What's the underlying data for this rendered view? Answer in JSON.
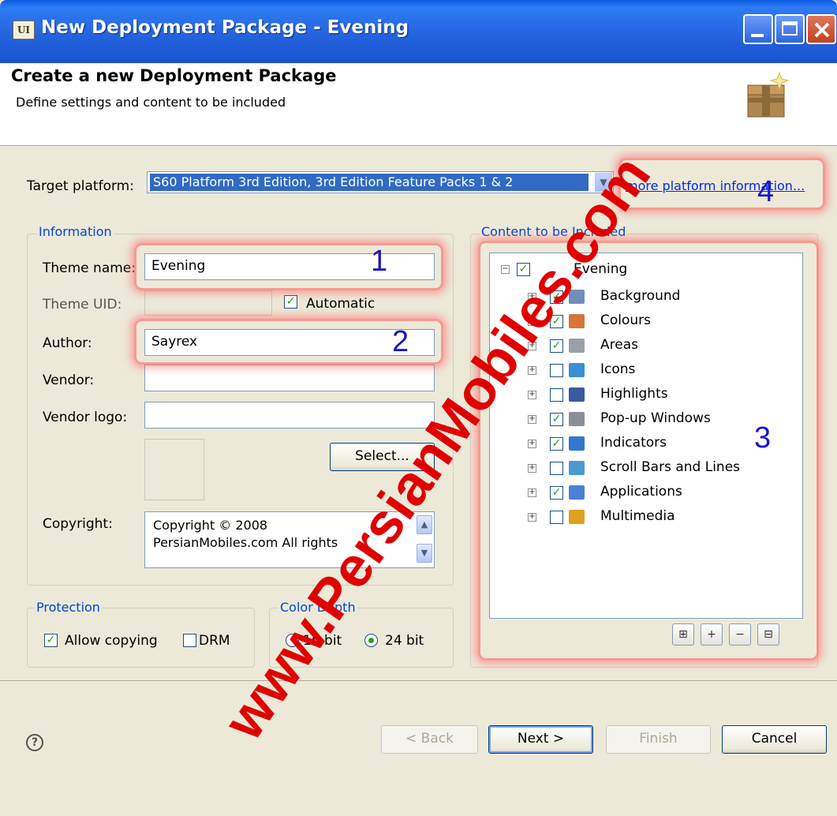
{
  "window": {
    "title": "New Deployment Package - Evening",
    "app_icon_text": "UI"
  },
  "header": {
    "title": "Create a new Deployment Package",
    "subtitle": "Define settings and content to be included"
  },
  "target_platform": {
    "label": "Target platform:",
    "value": "S60 Platform 3rd Edition, 3rd Edition Feature Packs 1 & 2",
    "more_link": "more platform information..."
  },
  "information": {
    "title": "Information",
    "theme_name_label": "Theme name:",
    "theme_name": "Evening",
    "theme_uid_label": "Theme UID:",
    "theme_uid": "",
    "automatic_label": "Automatic",
    "automatic_checked": true,
    "author_label": "Author:",
    "author": "Sayrex",
    "vendor_label": "Vendor:",
    "vendor": "",
    "vendor_logo_label": "Vendor logo:",
    "vendor_logo": "",
    "select_label": "Select...",
    "copyright_label": "Copyright:",
    "copyright": "Copyright © 2008\nPersianMobiles.com All rights"
  },
  "protection": {
    "title": "Protection",
    "allow_copying_label": "Allow copying",
    "allow_copying_checked": true,
    "drm_label": "DRM",
    "drm_checked": false
  },
  "color_depth": {
    "title": "Color Depth",
    "opt16_label": "16 bit",
    "opt24_label": "24 bit",
    "selected": "24 bit"
  },
  "content": {
    "title": "Content to be Included",
    "root": {
      "label": "Evening",
      "checked": true
    },
    "items": [
      {
        "label": "Background",
        "checked": true,
        "icon": "background-icon",
        "color": "#6f8fb8"
      },
      {
        "label": "Colours",
        "checked": true,
        "icon": "palette-icon",
        "color": "#d7743a"
      },
      {
        "label": "Areas",
        "checked": true,
        "icon": "areas-icon",
        "color": "#9aa0a8"
      },
      {
        "label": "Icons",
        "checked": false,
        "icon": "icons-icon",
        "color": "#3a8fd6"
      },
      {
        "label": "Highlights",
        "checked": false,
        "icon": "highlights-icon",
        "color": "#3a5aa0"
      },
      {
        "label": "Pop-up Windows",
        "checked": true,
        "icon": "popup-icon",
        "color": "#8a8f98"
      },
      {
        "label": "Indicators",
        "checked": true,
        "icon": "indicators-icon",
        "color": "#3277d0"
      },
      {
        "label": "Scroll Bars and Lines",
        "checked": false,
        "icon": "scrollbars-icon",
        "color": "#4a9ad0"
      },
      {
        "label": "Applications",
        "checked": true,
        "icon": "applications-icon",
        "color": "#4b7fd8"
      },
      {
        "label": "Multimedia",
        "checked": false,
        "icon": "multimedia-icon",
        "color": "#e0a020"
      }
    ],
    "toolbar": [
      "expand-all-icon",
      "expand-icon",
      "collapse-icon",
      "collapse-all-icon"
    ]
  },
  "footer": {
    "back_label": "< Back",
    "next_label": "Next >",
    "finish_label": "Finish",
    "cancel_label": "Cancel"
  },
  "annotations": {
    "n1": "1",
    "n2": "2",
    "n3": "3",
    "n4": "4"
  },
  "watermark": "www.PersianMobiles.com"
}
